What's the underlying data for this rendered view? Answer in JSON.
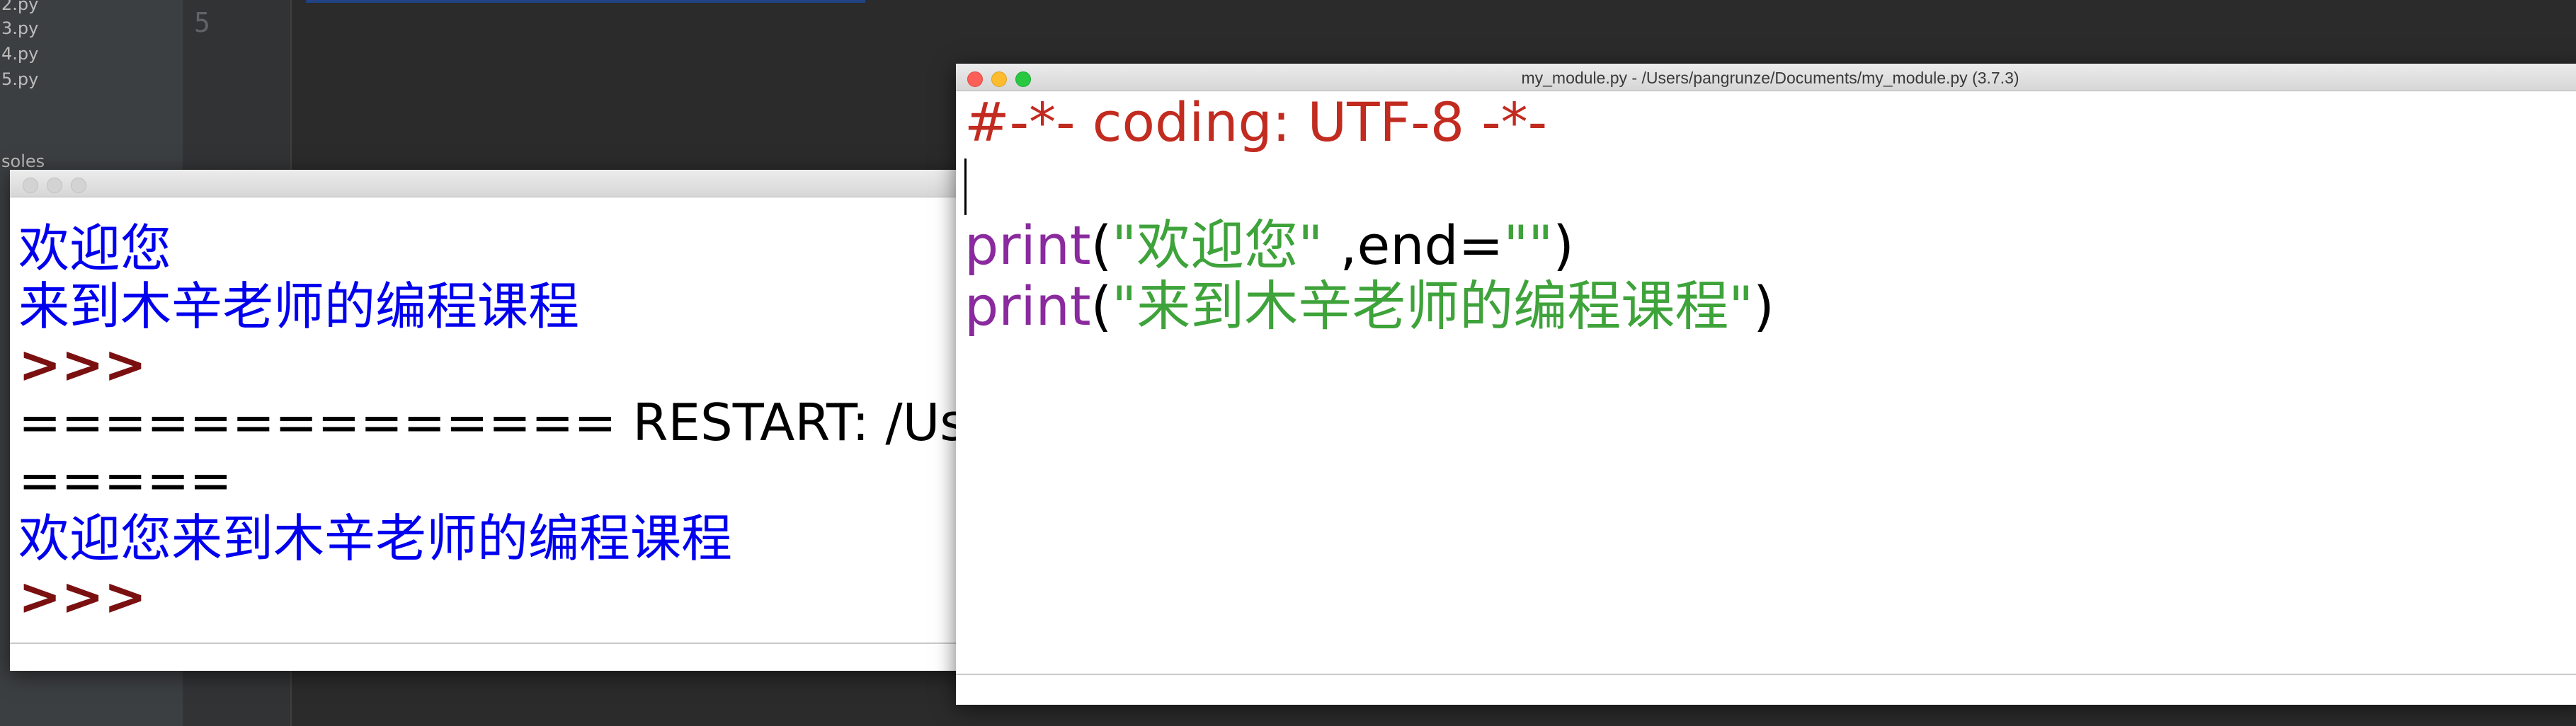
{
  "ide": {
    "sidebar_files": [
      "2.py",
      "3.py",
      "4.py",
      "5.py"
    ],
    "sidebar_section": "soles",
    "gutter_line_number": "5"
  },
  "shell": {
    "lines": [
      {
        "type": "cn",
        "text": "欢迎您"
      },
      {
        "type": "cn",
        "text": "来到木辛老师的编程课程"
      },
      {
        "type": "prompt",
        "text": ">>>"
      },
      {
        "type": "plain",
        "text": "============== RESTART: /Users/p"
      },
      {
        "type": "plain",
        "text": "====="
      },
      {
        "type": "cn",
        "text": "欢迎您来到木辛老师的编程课程"
      },
      {
        "type": "prompt",
        "text": ">>>"
      }
    ]
  },
  "module": {
    "title": "my_module.py - /Users/pangrunze/Documents/my_module.py (3.7.3)",
    "code": {
      "line1": "#-*- coding: UTF-8 -*-",
      "line3": {
        "kw": "print",
        "open": "(",
        "str": "\"欢迎您\"",
        "rest": " ,end=",
        "str2": "\"\"",
        "close": ")"
      },
      "line4": {
        "kw": "print",
        "open": "(",
        "str": "\"来到木辛老师的编程课程\"",
        "close": ")"
      }
    }
  }
}
